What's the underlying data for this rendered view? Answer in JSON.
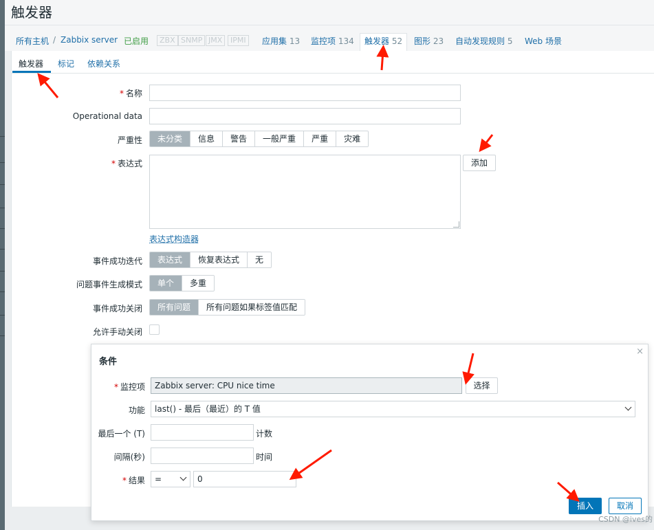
{
  "page": {
    "title": "触发器"
  },
  "hostnav": {
    "all_hosts": "所有主机",
    "separator": "/",
    "host": "Zabbix server",
    "status": "已启用",
    "protocols": [
      "ZBX",
      "SNMP",
      "JMX",
      "IPMI"
    ],
    "applications": {
      "label": "应用集",
      "count": "13"
    },
    "items": {
      "label": "监控项",
      "count": "134"
    },
    "triggers": {
      "label": "触发器",
      "count": "52"
    },
    "graphs": {
      "label": "图形",
      "count": "23"
    },
    "discovery": {
      "label": "自动发现规则",
      "count": "5"
    },
    "web": {
      "label": "Web 场景"
    }
  },
  "tabs": [
    "触发器",
    "标记",
    "依赖关系"
  ],
  "form": {
    "name_label": "名称",
    "opdata_label": "Operational data",
    "severity_label": "严重性",
    "severity_options": [
      "未分类",
      "信息",
      "警告",
      "一般严重",
      "严重",
      "灾难"
    ],
    "expression_label": "表达式",
    "add_button": "添加",
    "expression_constructor_link": "表达式构造器",
    "ok_event_label": "事件成功迭代",
    "ok_event_options": [
      "表达式",
      "恢复表达式",
      "无"
    ],
    "problem_mode_label": "问题事件生成模式",
    "problem_mode_options": [
      "单个",
      "多重"
    ],
    "ok_close_label": "事件成功关闭",
    "ok_close_options": [
      "所有问题",
      "所有问题如果标签值匹配"
    ],
    "manual_close_label": "允许手动关闭"
  },
  "dialog": {
    "title": "条件",
    "close_glyph": "×",
    "item_label": "监控项",
    "item_value": "Zabbix server: CPU nice time",
    "select_button": "选择",
    "function_label": "功能",
    "function_value": "last() - 最后（最近）的 T 值",
    "last_label": "最后一个 (T)",
    "last_unit": "计数",
    "interval_label": "间隔(秒)",
    "interval_unit": "时间",
    "result_label": "结果",
    "result_operator": "=",
    "result_value": "0",
    "insert_button": "插入",
    "cancel_button": "取消"
  },
  "watermark": "CSDN @ives的",
  "colors": {
    "accent": "#0275b8",
    "annotation_arrow": "#ff1a00",
    "enabled": "#429e47",
    "required": "#d40000"
  }
}
